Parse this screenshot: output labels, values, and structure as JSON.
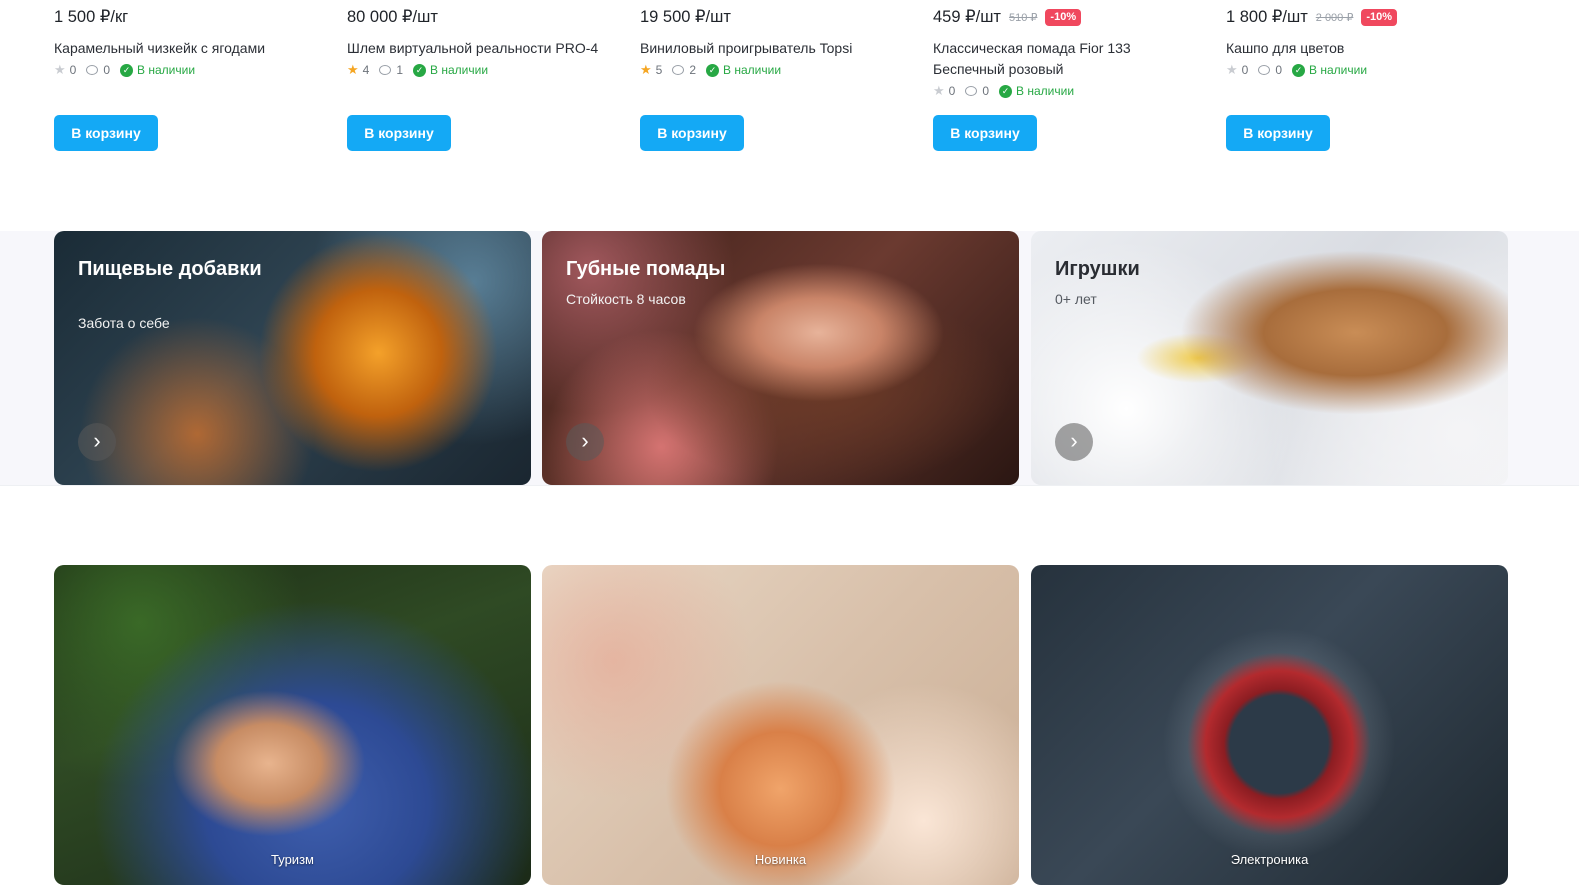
{
  "products": [
    {
      "price": "1 500 ₽/кг",
      "old_price": "",
      "discount": "",
      "name": "Карамельный чизкейк с ягодами",
      "rating": "0",
      "rated": false,
      "comments": "0",
      "stock": "В наличии",
      "button": "В корзину"
    },
    {
      "price": "80 000 ₽/шт",
      "old_price": "",
      "discount": "",
      "name": "Шлем виртуальной реальности PRO-4",
      "rating": "4",
      "rated": true,
      "comments": "1",
      "stock": "В наличии",
      "button": "В корзину"
    },
    {
      "price": "19 500 ₽/шт",
      "old_price": "",
      "discount": "",
      "name": "Виниловый проигрыватель Topsi",
      "rating": "5",
      "rated": true,
      "comments": "2",
      "stock": "В наличии",
      "button": "В корзину"
    },
    {
      "price": "459 ₽/шт",
      "old_price": "510 ₽",
      "discount": "-10%",
      "name": "Классическая помада Fior 133 Беспечный розовый",
      "rating": "0",
      "rated": false,
      "comments": "0",
      "stock": "В наличии",
      "button": "В корзину"
    },
    {
      "price": "1 800 ₽/шт",
      "old_price": "2 000 ₽",
      "discount": "-10%",
      "name": "Кашпо для цветов",
      "rating": "0",
      "rated": false,
      "comments": "0",
      "stock": "В наличии",
      "button": "В корзину"
    }
  ],
  "promos": [
    {
      "title": "Пищевые добавки",
      "subtitle": "Забота о себе",
      "icon": "chevron-right-icon"
    },
    {
      "title": "Губные помады",
      "subtitle": "Стойкость 8 часов",
      "icon": "chevron-right-icon"
    },
    {
      "title": "Игрушки",
      "subtitle": "0+ лет",
      "icon": "chevron-right-icon"
    }
  ],
  "categories": [
    {
      "label": "Туризм"
    },
    {
      "label": "Новинка"
    },
    {
      "label": "Электроника"
    }
  ],
  "colors": {
    "accent": "#14a9f5",
    "discount": "#f0485e",
    "in_stock": "#27a844",
    "star": "#f5a623"
  }
}
